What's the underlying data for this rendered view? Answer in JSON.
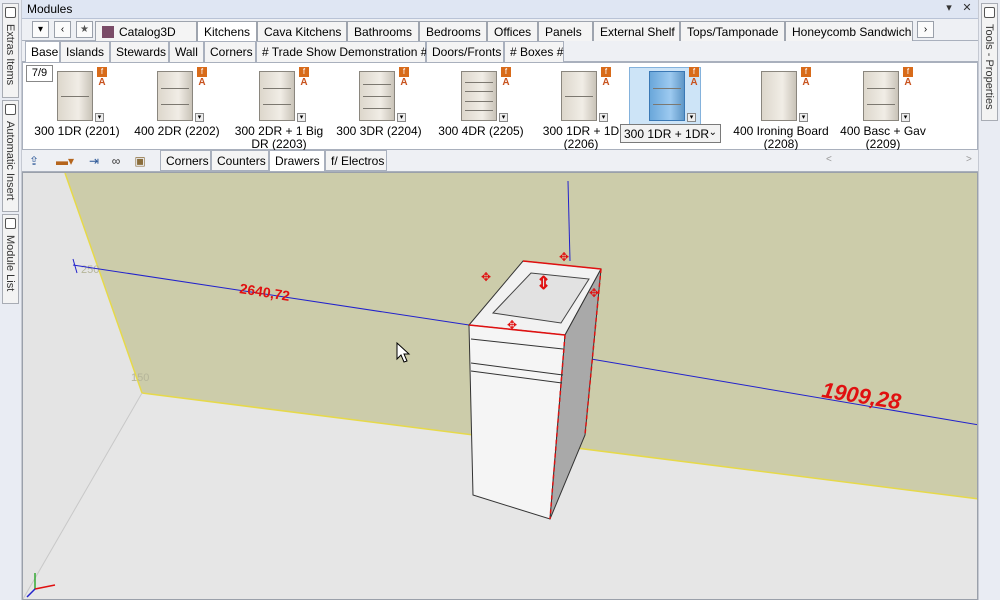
{
  "window": {
    "title": "Modules",
    "pin": "▾",
    "close": "✕"
  },
  "left_rail": {
    "tabs": [
      "Extras Items",
      "Automatic Insert",
      "Module List"
    ]
  },
  "right_rail": {
    "tabs": [
      "Tools - Properties"
    ]
  },
  "category_bar": {
    "dropdown": "▾",
    "back": "‹",
    "favorites": "★",
    "more": "›",
    "tabs": [
      "Catalog3D",
      "Kitchens",
      "Cava Kitchens",
      "Bathrooms",
      "Bedrooms",
      "Offices",
      "Panels",
      "External Shelf",
      "Tops/Tamponade",
      "Honeycomb Sandwich"
    ],
    "active": "Kitchens"
  },
  "sub_bar": {
    "tabs": [
      "Base",
      "Islands",
      "Stewards",
      "Wall",
      "Corners",
      "# Trade Show Demonstration #",
      "Doors/Fronts",
      "# Boxes #"
    ],
    "active": "Base"
  },
  "gallery": {
    "page": "7/9",
    "items": [
      {
        "label": "300 1DR (2201)",
        "drawers": 1
      },
      {
        "label": "400 2DR (2202)",
        "drawers": 2
      },
      {
        "label": "300 2DR + 1 Big DR (2203)",
        "drawers": 2
      },
      {
        "label": "300 3DR (2204)",
        "drawers": 3
      },
      {
        "label": "300 4DR (2205)",
        "drawers": 4
      },
      {
        "label": "300 1DR + 1D (2206)",
        "drawers": 1
      },
      {
        "label": "300 1DR + 1DR",
        "drawers": 2,
        "selected": true
      },
      {
        "label": "400 Ironing Board (2208)",
        "drawers": 0
      },
      {
        "label": "400 Basc + Gav (2209)",
        "drawers": 2
      }
    ]
  },
  "toolbar": {
    "tabs": [
      "Corners",
      "Counters",
      "Drawers",
      "f/ Electros"
    ],
    "active": "Drawers"
  },
  "scene": {
    "dim_top": "2640,72",
    "dim_right": "1909,28",
    "tick_a": "250",
    "tick_b": "150"
  }
}
